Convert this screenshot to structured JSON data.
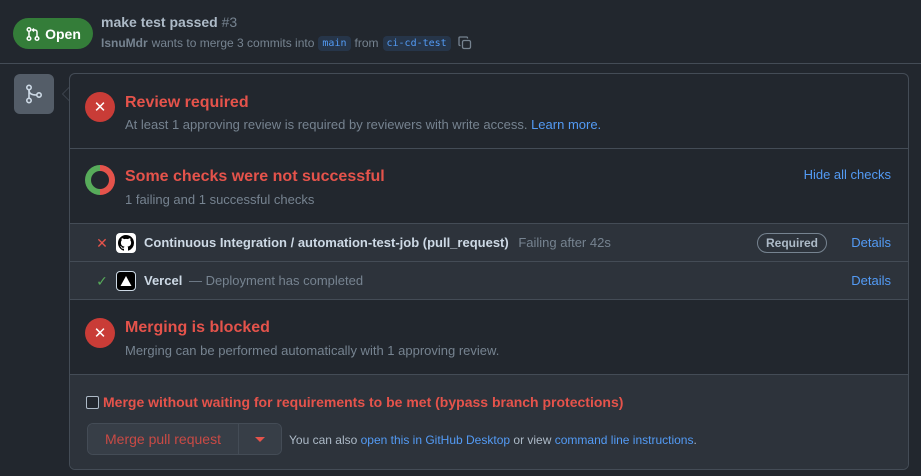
{
  "pr": {
    "state": "Open",
    "title": "make test passed",
    "number": "#3",
    "author": "IsnuMdr",
    "meta_text": "wants to merge 3 commits into",
    "base_branch": "main",
    "from_text": "from",
    "head_branch": "ci-cd-test"
  },
  "review": {
    "title": "Review required",
    "subtitle": "At least 1 approving review is required by reviewers with write access.",
    "link": "Learn more."
  },
  "checks": {
    "title": "Some checks were not successful",
    "subtitle": "1 failing and 1 successful checks",
    "toggle": "Hide all checks",
    "items": [
      {
        "status": "fail",
        "status_icon": "✕",
        "name": "Continuous Integration / automation-test-job (pull_request)",
        "description": "Failing after 42s",
        "badge": "Required",
        "details": "Details"
      },
      {
        "status": "success",
        "status_icon": "✓",
        "name": "Vercel",
        "description": "— Deployment has completed",
        "details": "Details"
      }
    ]
  },
  "blocked": {
    "title": "Merging is blocked",
    "subtitle": "Merging can be performed automatically with 1 approving review."
  },
  "actions": {
    "bypass_label": "Merge without waiting for requirements to be met (bypass branch protections)",
    "merge_button": "Merge pull request",
    "also_prefix": "You can also",
    "desktop_link": "open this in GitHub Desktop",
    "or_view": "or view",
    "cli_link": "command line instructions",
    "period": "."
  },
  "colors": {
    "background": "#22272e",
    "open_badge": "#347d39",
    "danger": "#e5534b",
    "success": "#57ab5a",
    "link": "#539bf5"
  }
}
